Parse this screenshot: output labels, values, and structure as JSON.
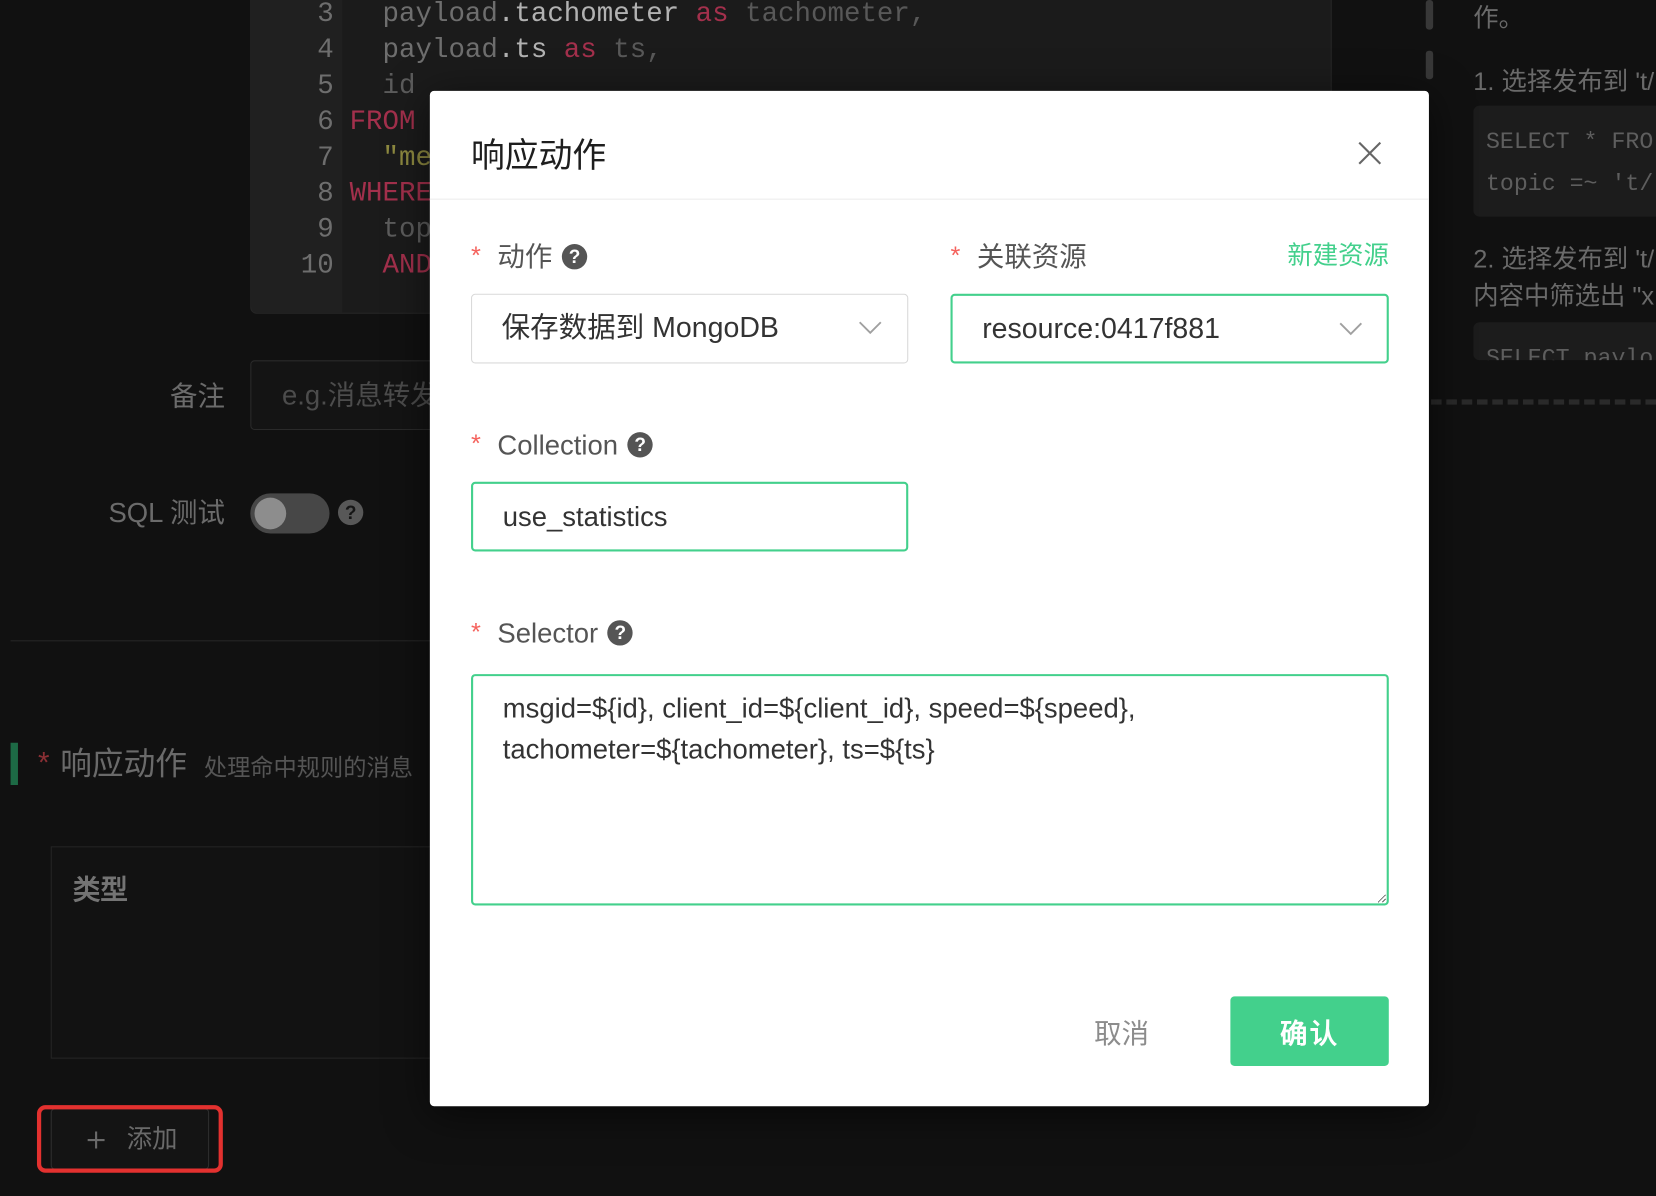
{
  "colors": {
    "accent": "#43d08c",
    "required": "#f5625d",
    "annotation": "#e3312f"
  },
  "icons": {
    "help": "question-circle-icon",
    "help_glyph": "?",
    "close": "close-icon",
    "chevron": "chevron-down-icon",
    "plus": "plus-icon"
  },
  "editor": {
    "lines": [
      {
        "num": "3",
        "tokens": [
          "  payload",
          ".tachometer",
          " as ",
          "tachometer,"
        ]
      },
      {
        "num": "4",
        "tokens": [
          "  payload",
          ".ts",
          " as ",
          "ts,"
        ]
      },
      {
        "num": "5",
        "tokens": [
          "  id"
        ]
      },
      {
        "num": "6",
        "tokens": [
          "FROM"
        ]
      },
      {
        "num": "7",
        "tokens": [
          "  \"me"
        ]
      },
      {
        "num": "8",
        "tokens": [
          "WHERE"
        ]
      },
      {
        "num": "9",
        "tokens": [
          "  top"
        ]
      },
      {
        "num": "10",
        "tokens": [
          "  AND"
        ]
      }
    ]
  },
  "guide": {
    "line_top": "作。",
    "step1": "1. 选择发布到 't/",
    "code1": [
      "SELECT * FRO",
      "topic =~ 't/"
    ],
    "step2_line1": "2. 选择发布到 't/",
    "step2_line2": "内容中筛选出 \"x",
    "code2": [
      "SELECT paylo"
    ]
  },
  "form": {
    "remark_label": "备注",
    "remark_placeholder": "e.g.消息转发",
    "sql_test_label": "SQL 测试",
    "sql_test_enabled": false
  },
  "actions_section": {
    "required_mark": "*",
    "title": "响应动作",
    "subtitle": "处理命中规则的消息",
    "table_header_type": "类型",
    "add_label": "添加"
  },
  "modal": {
    "title": "响应动作",
    "required_mark": "*",
    "fields": {
      "action": {
        "label": "动作",
        "value": "保存数据到 MongoDB"
      },
      "resource": {
        "label": "关联资源",
        "value": "resource:0417f881",
        "link": "新建资源"
      },
      "collection": {
        "label": "Collection",
        "value": "use_statistics"
      },
      "selector": {
        "label": "Selector",
        "value": "msgid=${id}, client_id=${client_id}, speed=${speed}, tachometer=${tachometer}, ts=${ts}"
      }
    },
    "cancel_label": "取消",
    "confirm_label": "确认"
  }
}
